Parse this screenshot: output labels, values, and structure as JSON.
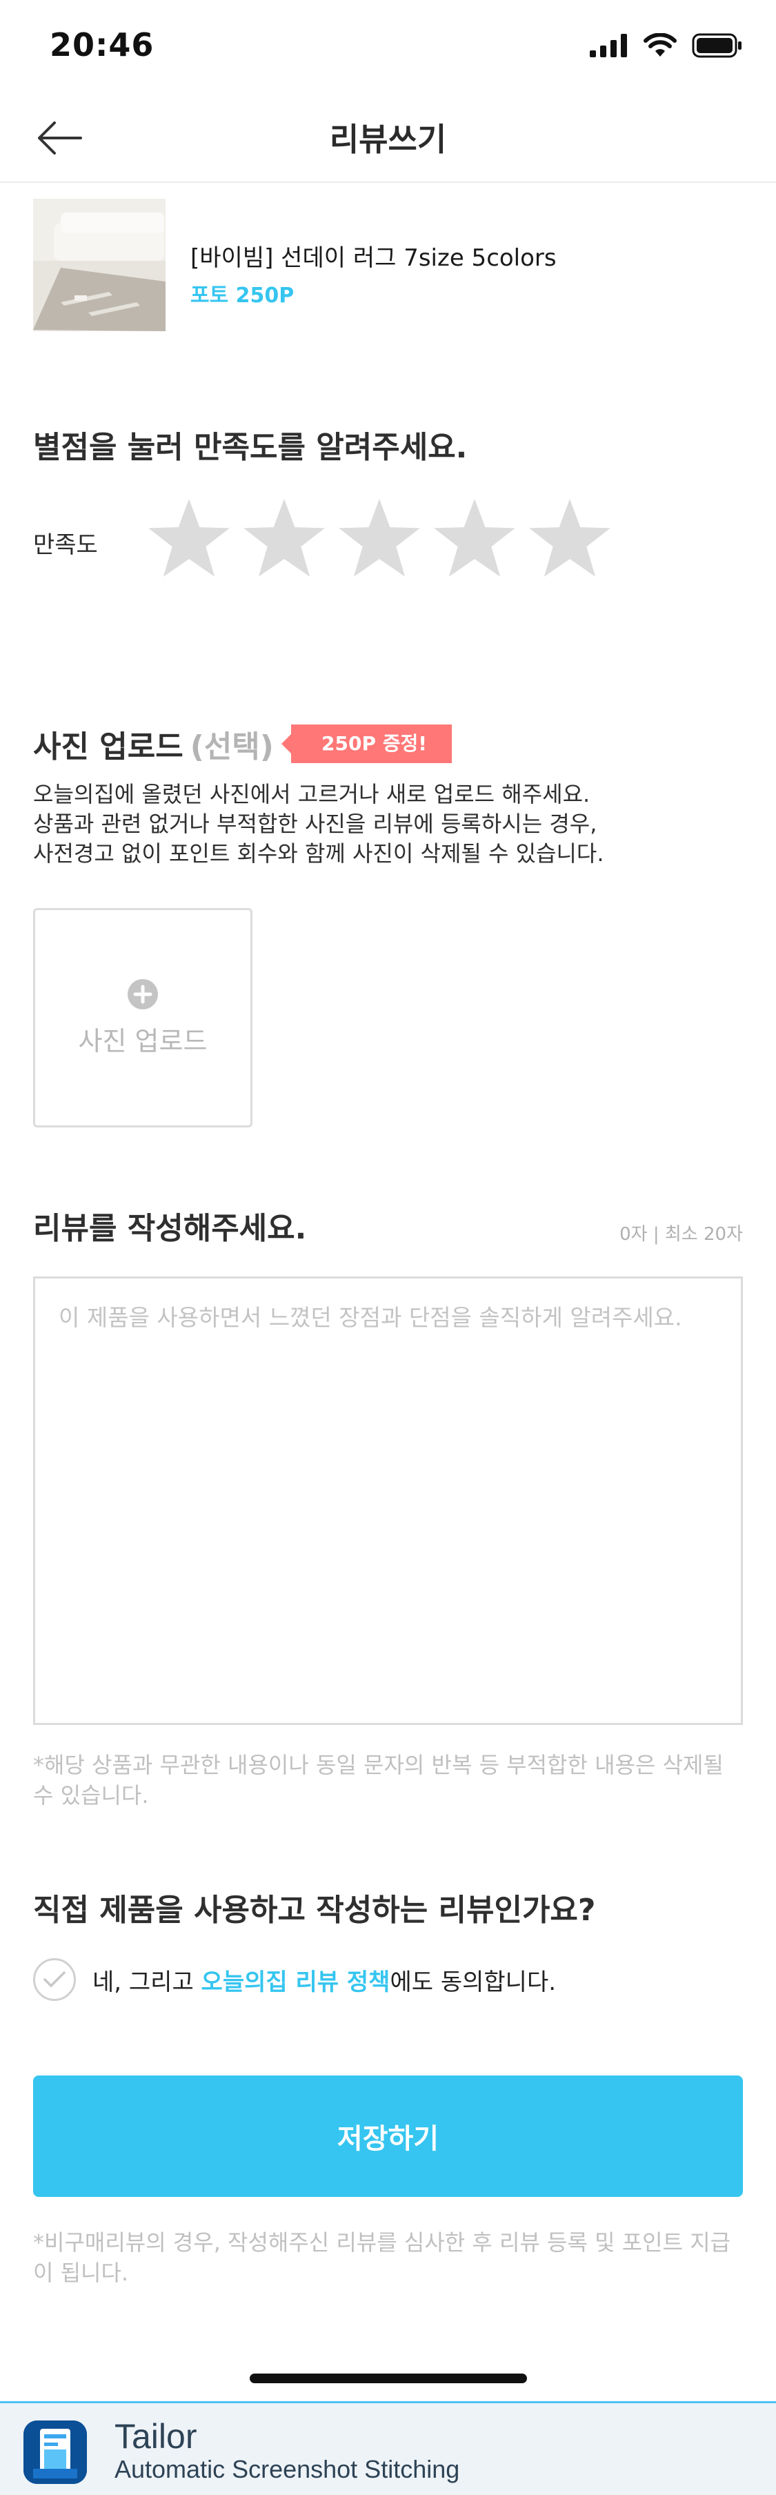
{
  "status_bar": {
    "time": "20:46"
  },
  "nav": {
    "title": "리뷰쓰기"
  },
  "product": {
    "name": "[바이빔] 선데이 러그 7size 5colors",
    "point": "포토 250P"
  },
  "rating": {
    "title": "별점을 눌러 만족도를 알려주세요.",
    "label": "만족도",
    "stars": 5,
    "selected": 0
  },
  "photo": {
    "title": "사진 업로드",
    "optional": "(선택)",
    "badge": "250P 증정!",
    "desc_line1": "오늘의집에 올렸던 사진에서 고르거나 새로 업로드 해주세요.",
    "desc_line2": "상품과 관련 없거나 부적합한 사진을 리뷰에 등록하시는 경우,",
    "desc_line3": "사전경고 없이 포인트 회수와 함께 사진이 삭제될 수 있습니다.",
    "upload_label": "사진 업로드"
  },
  "review": {
    "title": "리뷰를 작성해주세요.",
    "counter": "0자 | 최소 20자",
    "placeholder": "이 제품을 사용하면서 느꼈던 장점과 단점을 솔직하게 알려주세요.",
    "value": "",
    "notice": "*해당 상품과 무관한 내용이나 동일 문자의 반복 등 부적합한 내용은 삭제될 수 있습니다."
  },
  "confirm": {
    "title": "직접 제품을 사용하고 작성하는 리뷰인가요?",
    "agree_prefix": "네, 그리고 ",
    "agree_link": "오늘의집 리뷰 정책",
    "agree_suffix": "에도 동의합니다."
  },
  "submit": {
    "label": "저장하기"
  },
  "bottom_notice": "*비구매리뷰의 경우, 작성해주신 리뷰를 심사한 후 리뷰 등록 및 포인트 지급이 됩니다.",
  "banner": {
    "title": "Tailor",
    "subtitle": "Automatic Screenshot Stitching"
  },
  "colors": {
    "accent": "#35c5f0",
    "badge": "#ff7777",
    "star_empty": "#dcdcdc"
  },
  "icons": [
    "signal-icon",
    "wifi-icon",
    "battery-icon",
    "back-arrow-icon",
    "star-icon",
    "plus-circle-icon",
    "check-icon",
    "tailor-app-icon"
  ]
}
